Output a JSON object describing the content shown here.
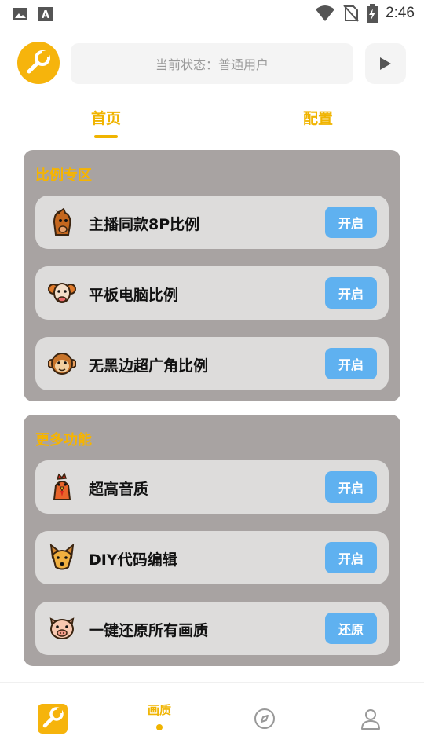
{
  "status_bar": {
    "time": "2:46"
  },
  "header": {
    "status_text": "当前状态：普通用户"
  },
  "tabs": [
    {
      "label": "首页"
    },
    {
      "label": "配置"
    }
  ],
  "sections": [
    {
      "title": "比例专区",
      "items": [
        {
          "icon": "horse-icon",
          "label": "主播同款8P比例",
          "button": "开启"
        },
        {
          "icon": "ram-icon",
          "label": "平板电脑比例",
          "button": "开启"
        },
        {
          "icon": "monkey-icon",
          "label": "无黑边超广角比例",
          "button": "开启"
        }
      ]
    },
    {
      "title": "更多功能",
      "items": [
        {
          "icon": "rooster-icon",
          "label": "超高音质",
          "button": "开启"
        },
        {
          "icon": "dog-icon",
          "label": "DIY代码编辑",
          "button": "开启"
        },
        {
          "icon": "pig-icon",
          "label": "一键还原所有画质",
          "button": "还原"
        }
      ]
    }
  ],
  "bottom_nav": {
    "active_label": "画质"
  },
  "colors": {
    "accent": "#f0b400",
    "button": "#5fb1f0",
    "panel": "#a8a3a2",
    "row": "#dddcdb"
  }
}
